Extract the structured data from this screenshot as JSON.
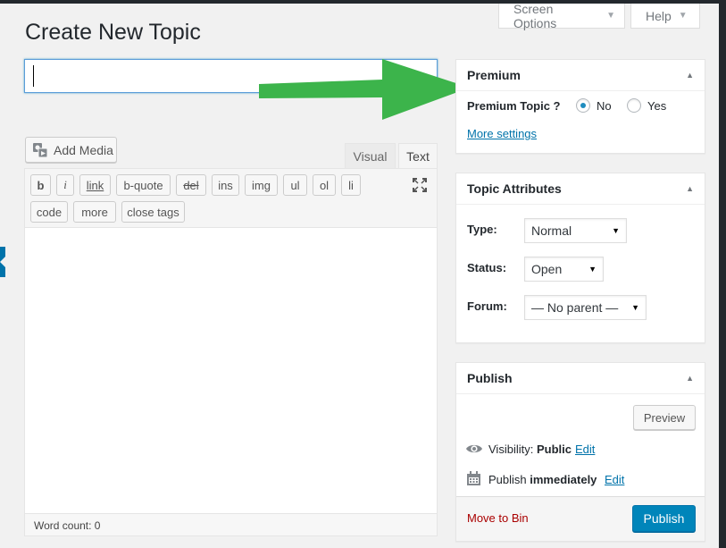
{
  "screen_meta": {
    "screen_options": "Screen Options",
    "help": "Help"
  },
  "page": {
    "title": "Create New Topic"
  },
  "editor": {
    "add_media": "Add Media",
    "tabs": {
      "visual": "Visual",
      "text": "Text"
    },
    "quicktags": [
      "b",
      "i",
      "link",
      "b-quote",
      "del",
      "ins",
      "img",
      "ul",
      "ol",
      "li",
      "code",
      "more",
      "close tags"
    ],
    "word_count": "Word count: 0"
  },
  "premium": {
    "title": "Premium",
    "field_label": "Premium Topic ?",
    "options": [
      "No",
      "Yes"
    ],
    "selected": "No",
    "more_settings": "More settings"
  },
  "attributes": {
    "title": "Topic Attributes",
    "type_label": "Type:",
    "type_value": "Normal",
    "status_label": "Status:",
    "status_value": "Open",
    "forum_label": "Forum:",
    "forum_value": "— No parent —"
  },
  "publish": {
    "title": "Publish",
    "preview": "Preview",
    "visibility_label": "Visibility:",
    "visibility_value": "Public",
    "publish_label": "Publish",
    "publish_value": "immediately",
    "edit": "Edit",
    "move_to_bin": "Move to Bin",
    "publish_button": "Publish"
  },
  "colors": {
    "accent": "#0085ba",
    "arrow": "#3cb44b",
    "link": "#0073aa",
    "danger": "#aa0000"
  }
}
